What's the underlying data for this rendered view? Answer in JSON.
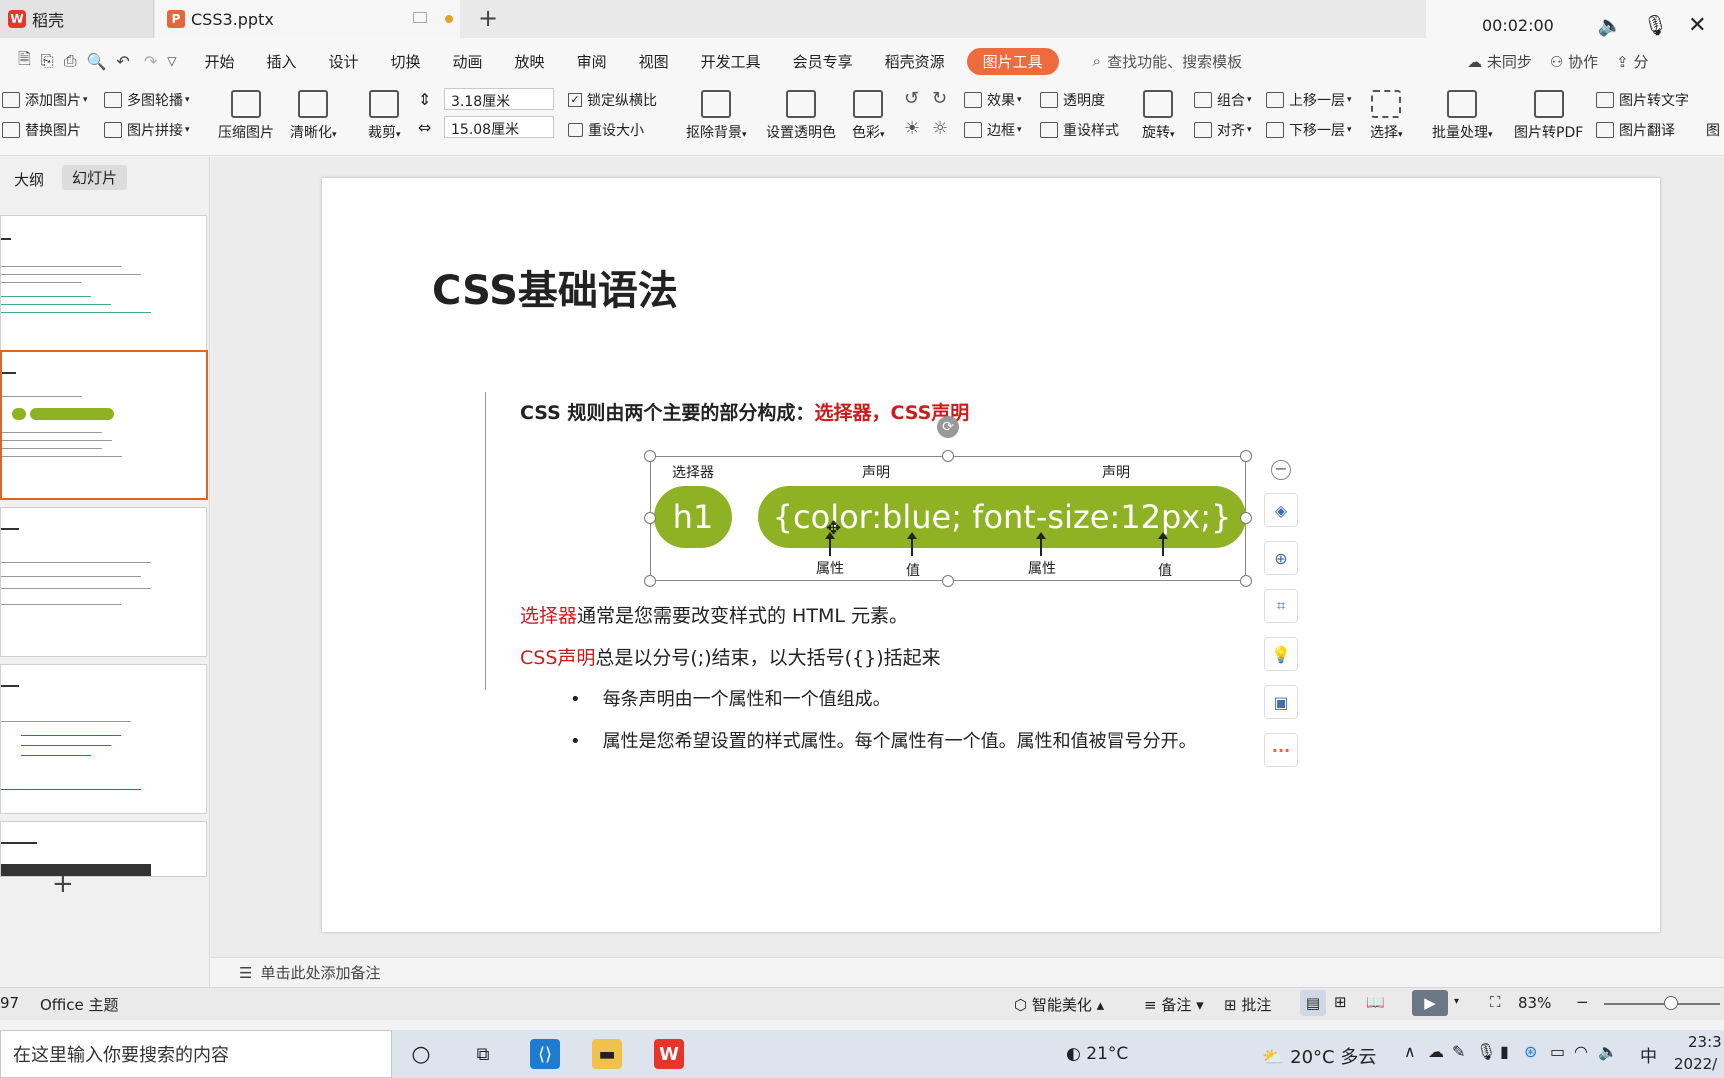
{
  "titlebar": {
    "home_tab": "稻壳",
    "file_tab": "CSS3.pptx",
    "new_tab": "+"
  },
  "recorder": {
    "time": "00:02:00"
  },
  "menu": {
    "items": [
      "开始",
      "插入",
      "设计",
      "切换",
      "动画",
      "放映",
      "审阅",
      "视图",
      "开发工具",
      "会员专享",
      "稻壳资源"
    ],
    "picture_tools": "图片工具",
    "search_placeholder": "查找功能、搜索模板",
    "sync": "未同步",
    "collab": "协作",
    "share": "分"
  },
  "toolbar": {
    "add_picture": "添加图片",
    "carousel": "多图轮播",
    "replace_picture": "替换图片",
    "stitch": "图片拼接",
    "compress": "压缩图片",
    "sharpen": "清晰化",
    "crop": "裁剪",
    "height": "3.18厘米",
    "width": "15.08厘米",
    "lock_ratio": "锁定纵横比",
    "reset_size": "重设大小",
    "remove_bg": "抠除背景",
    "set_transparent": "设置透明色",
    "color": "色彩",
    "effects": "效果",
    "transparency": "透明度",
    "border": "边框",
    "reset_style": "重设样式",
    "rotate": "旋转",
    "group": "组合",
    "align": "对齐",
    "bring_forward": "上移一层",
    "send_backward": "下移一层",
    "select": "选择",
    "batch": "批量处理",
    "to_pdf": "图片转PDF",
    "to_text": "图片转文字",
    "translate": "图片翻译",
    "more": "图"
  },
  "leftpane": {
    "tab_outline": "大纲",
    "tab_slides": "幻灯片",
    "add_slide": "+"
  },
  "slide": {
    "title": "CSS基础语法",
    "intro_prefix": "CSS 规则由两个主要的部分构成：",
    "intro_red": "选择器，CSS声明",
    "diagram": {
      "selector_label": "选择器",
      "decl_label_1": "声明",
      "decl_label_2": "声明",
      "selector": "h1",
      "declaration": "{color:blue; font-size:12px;}",
      "prop1": "属性",
      "val1": "值",
      "prop2": "属性",
      "val2": "值"
    },
    "line1_red": "选择器",
    "line1_rest": "通常是您需要改变样式的 HTML 元素。",
    "line2_red": "CSS声明",
    "line2_rest": "总是以分号(;)结束，以大括号({})括起来",
    "bullets": [
      "每条声明由一个属性和一个值组成。",
      "属性是您希望设置的样式属性。每个属性有一个值。属性和值被冒号分开。"
    ]
  },
  "notes": {
    "placeholder": "单击此处添加备注"
  },
  "status": {
    "slide_num": "97",
    "theme": "Office 主题",
    "beautify": "智能美化",
    "notes": "备注",
    "comments": "批注",
    "zoom": "83%"
  },
  "taskbar": {
    "search_placeholder": "在这里输入你要搜索的内容",
    "weather1": "21°C",
    "weather2": "20°C 多云",
    "ime": "中",
    "time": "23:3",
    "date": "2022/"
  },
  "colors": {
    "accent": "#ef6a3c",
    "pill": "#8fb225",
    "red": "#cc1b1b"
  }
}
